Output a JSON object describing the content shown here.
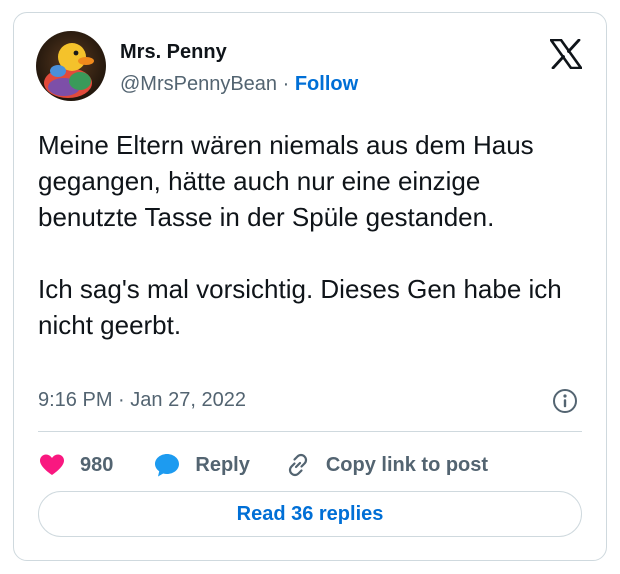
{
  "author": {
    "name": "Mrs. Penny",
    "handle": "@MrsPennyBean",
    "separator": "·",
    "follow_label": "Follow",
    "avatar_icon": "rubber-duck-avatar"
  },
  "platform_icon": "x-logo-icon",
  "tweet": {
    "paragraphs": [
      "Meine Eltern wären niemals aus dem Haus gegangen, hätte auch nur eine einzige benutzte Tasse in der Spüle gestanden.",
      "Ich sag's mal vorsichtig. Dieses Gen habe ich nicht geerbt."
    ],
    "time": "9:16 PM",
    "separator": "·",
    "date": "Jan 27, 2022"
  },
  "actions": {
    "likes_count": "980",
    "reply_label": "Reply",
    "copy_link_label": "Copy link to post"
  },
  "read_replies_label": "Read 36 replies",
  "colors": {
    "like": "#f91880",
    "reply": "#1d9bf0",
    "link": "#006fd6",
    "muted": "#536471",
    "border": "#cfd9de"
  }
}
